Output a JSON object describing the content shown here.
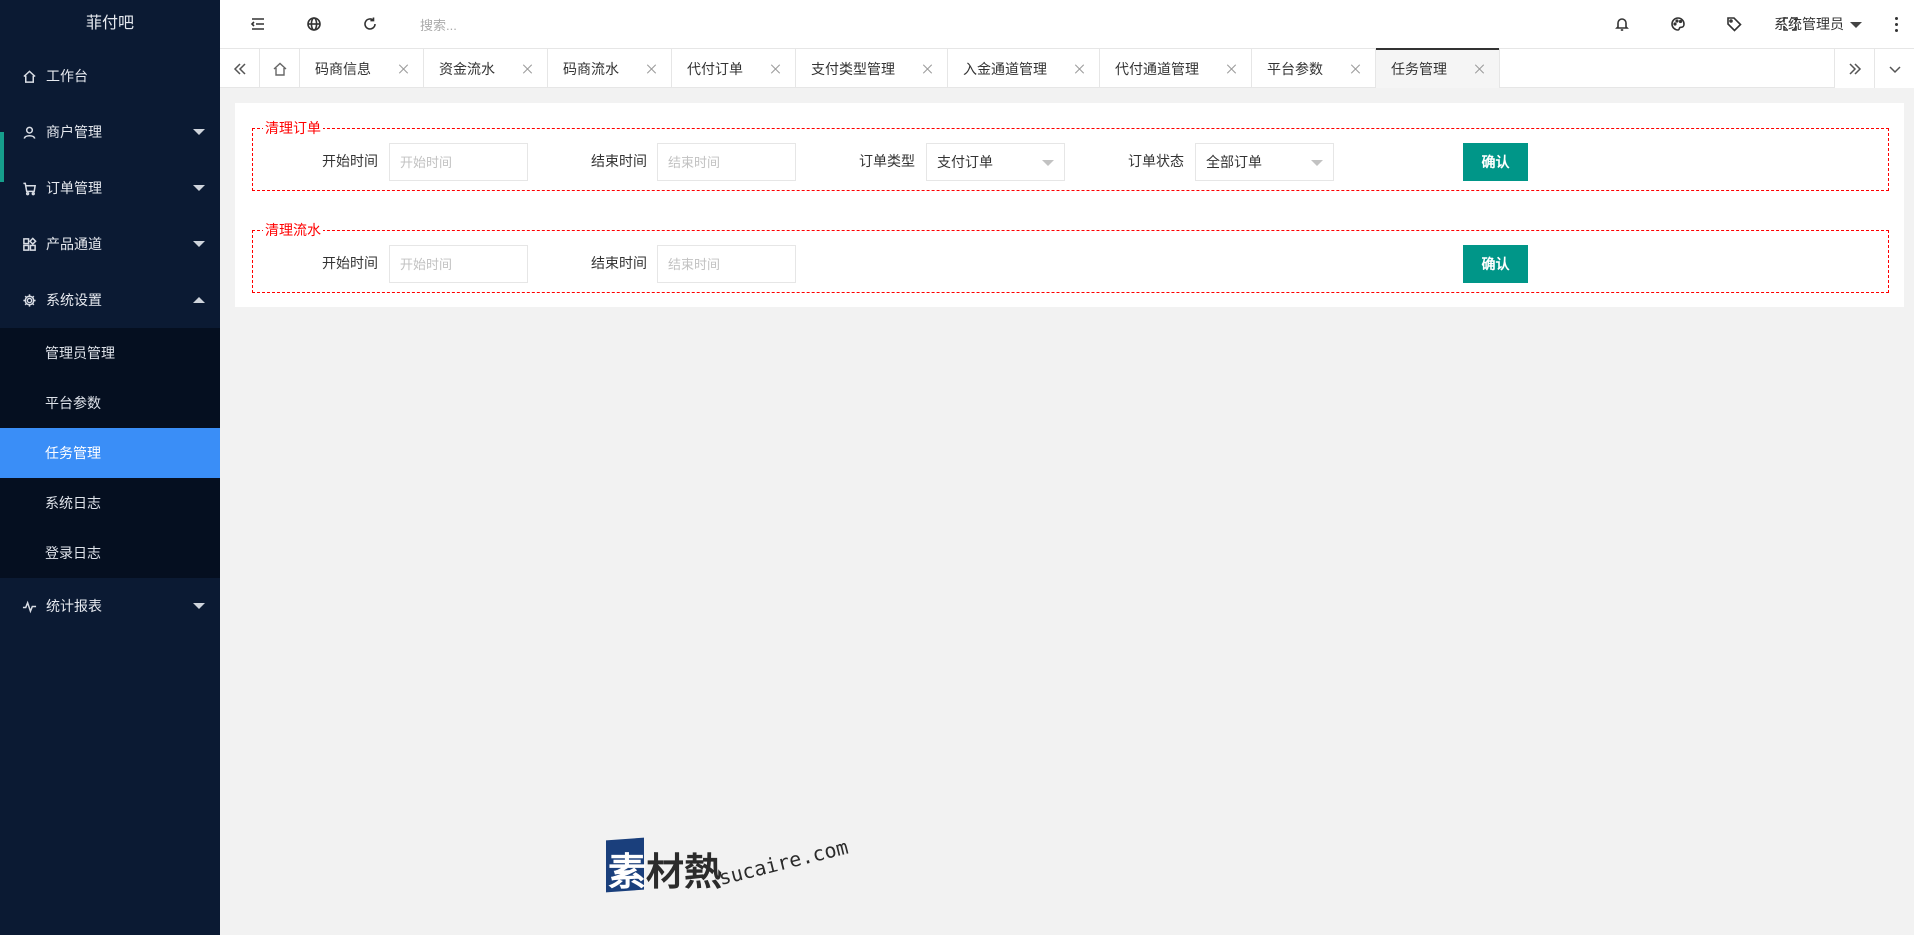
{
  "app": {
    "title": "菲付吧"
  },
  "sidebar": {
    "items": [
      {
        "label": "工作台",
        "icon": "home-icon"
      },
      {
        "label": "商户管理",
        "icon": "user-icon"
      },
      {
        "label": "订单管理",
        "icon": "cart-icon"
      },
      {
        "label": "产品通道",
        "icon": "apps-icon"
      },
      {
        "label": "系统设置",
        "icon": "gear-icon"
      },
      {
        "label": "统计报表",
        "icon": "pulse-icon"
      }
    ],
    "system_submenu": [
      "管理员管理",
      "平台参数",
      "任务管理",
      "系统日志",
      "登录日志"
    ],
    "active_sub": "任务管理"
  },
  "header": {
    "search_placeholder": "搜索...",
    "user": "系统管理员",
    "icons": [
      "menu-fold-icon",
      "globe-icon",
      "refresh-icon",
      "bell-icon",
      "theme-icon",
      "tag-icon",
      "fullscreen-icon",
      "more-icon"
    ]
  },
  "tabs": {
    "items": [
      "码商信息",
      "资金流水",
      "码商流水",
      "代付订单",
      "支付类型管理",
      "入金通道管理",
      "代付通道管理",
      "平台参数",
      "任务管理"
    ],
    "active": "任务管理"
  },
  "clear_orders": {
    "legend": "清理订单",
    "start_label": "开始时间",
    "start_placeholder": "开始时间",
    "end_label": "结束时间",
    "end_placeholder": "结束时间",
    "type_label": "订单类型",
    "type_value": "支付订单",
    "status_label": "订单状态",
    "status_value": "全部订单",
    "confirm": "确认"
  },
  "clear_flow": {
    "legend": "清理流水",
    "start_label": "开始时间",
    "start_placeholder": "开始时间",
    "end_label": "结束时间",
    "end_placeholder": "结束时间",
    "confirm": "确认"
  },
  "watermark": {
    "zh": "素材熱",
    "en": "sucaire.com"
  },
  "colors": {
    "sidebar_bg": "#0b1a33",
    "active_blue": "#3a8ef7",
    "confirm_green": "#009688",
    "dashed_red": "#ff0000"
  }
}
